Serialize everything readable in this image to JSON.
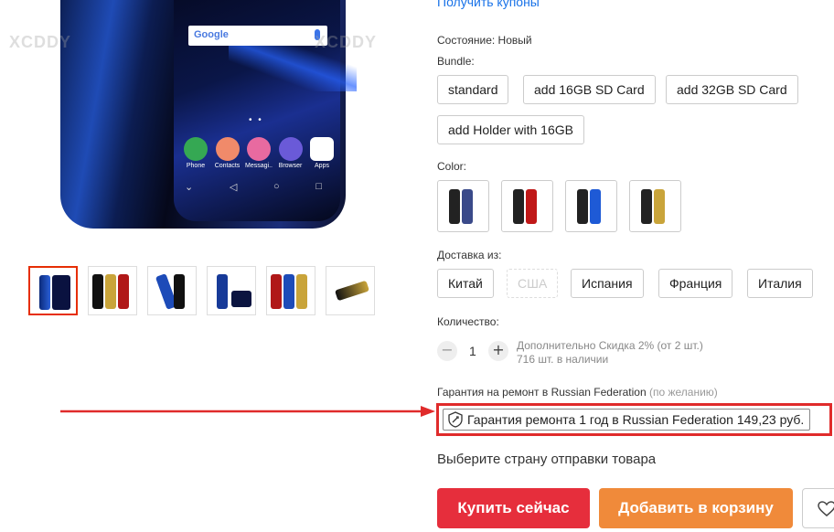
{
  "coupons_link": "Получить купоны",
  "condition": "Состояние: Новый",
  "bundle": {
    "label": "Bundle:",
    "options": [
      "standard",
      "add 16GB SD Card",
      "add 32GB SD Card",
      "add Holder with 16GB"
    ]
  },
  "color": {
    "label": "Color:",
    "swatches": [
      {
        "name": "dark-blue",
        "accent": "#3a4a8a"
      },
      {
        "name": "red",
        "accent": "#c01818"
      },
      {
        "name": "blue",
        "accent": "#1e5ad6"
      },
      {
        "name": "gold",
        "accent": "#c9a43a"
      }
    ]
  },
  "shipping": {
    "label": "Доставка из:",
    "options": [
      "Китай",
      "США",
      "Испания",
      "Франция",
      "Италия"
    ]
  },
  "quantity": {
    "label": "Количество:",
    "value": "1",
    "minus": "−",
    "plus": "+",
    "discount": "Дополнительно Скидка 2% (от 2 шт.)",
    "stock": "716 шт. в наличии"
  },
  "warranty": {
    "label": "Гарантия на ремонт в Russian Federation",
    "optional": "(по желанию)",
    "option": "Гарантия ремонта 1 год в Russian Federation 149,23 руб."
  },
  "select_country": "Выберите страну отправки товара",
  "actions": {
    "buy_now": "Купить сейчас",
    "add_to_cart": "Добавить в корзину"
  },
  "phone_screen": {
    "search_brand": "Google",
    "apps": [
      "Phone",
      "Contacts",
      "Messagi..",
      "Browser",
      "Apps"
    ]
  },
  "watermark": "XCDDY",
  "colors": {
    "buy_now": "#e62e3c",
    "add_to_cart": "#f08a3a",
    "link": "#1a73e8",
    "highlight": "#e02b2b"
  }
}
